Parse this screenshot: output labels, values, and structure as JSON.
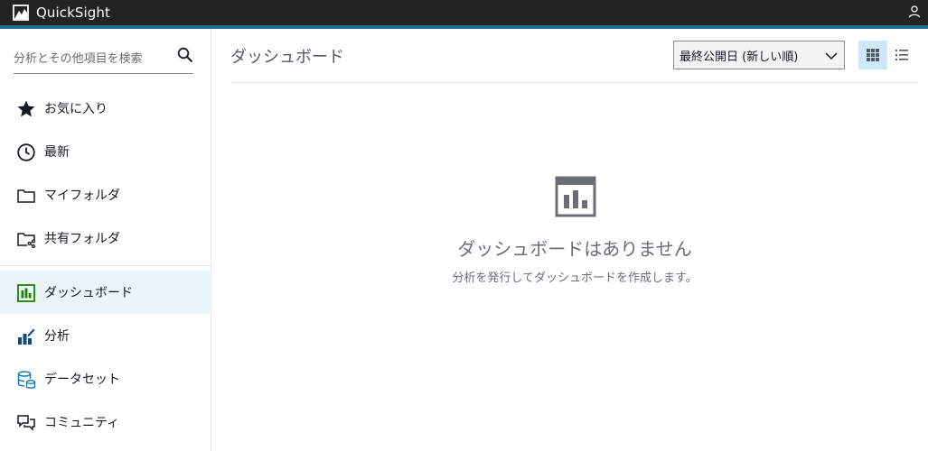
{
  "app": {
    "brand": "QuickSight"
  },
  "colors": {
    "topbar": "#232323",
    "accent": "#1f6f8f",
    "active_bg": "#e9f4fb",
    "grid_toggle_bg": "#cde9f7"
  },
  "sidebar": {
    "search": {
      "placeholder": "分析とその他項目を検索",
      "value": ""
    },
    "items": [
      {
        "label": "お気に入り",
        "icon": "star-icon",
        "active": false
      },
      {
        "label": "最新",
        "icon": "clock-icon",
        "active": false
      },
      {
        "label": "マイフォルダ",
        "icon": "folder-icon",
        "active": false
      },
      {
        "label": "共有フォルダ",
        "icon": "shared-folder-icon",
        "active": false
      },
      {
        "label": "ダッシュボード",
        "icon": "dashboard-icon",
        "active": true
      },
      {
        "label": "分析",
        "icon": "analysis-icon",
        "active": false
      },
      {
        "label": "データセット",
        "icon": "dataset-icon",
        "active": false
      },
      {
        "label": "コミュニティ",
        "icon": "community-icon",
        "active": false
      }
    ]
  },
  "main": {
    "title": "ダッシュボード",
    "sort": {
      "selected": "最終公開日 (新しい順)"
    },
    "view": {
      "selected": "grid"
    },
    "empty": {
      "title": "ダッシュボードはありません",
      "subtitle": "分析を発行してダッシュボードを作成します。"
    }
  }
}
